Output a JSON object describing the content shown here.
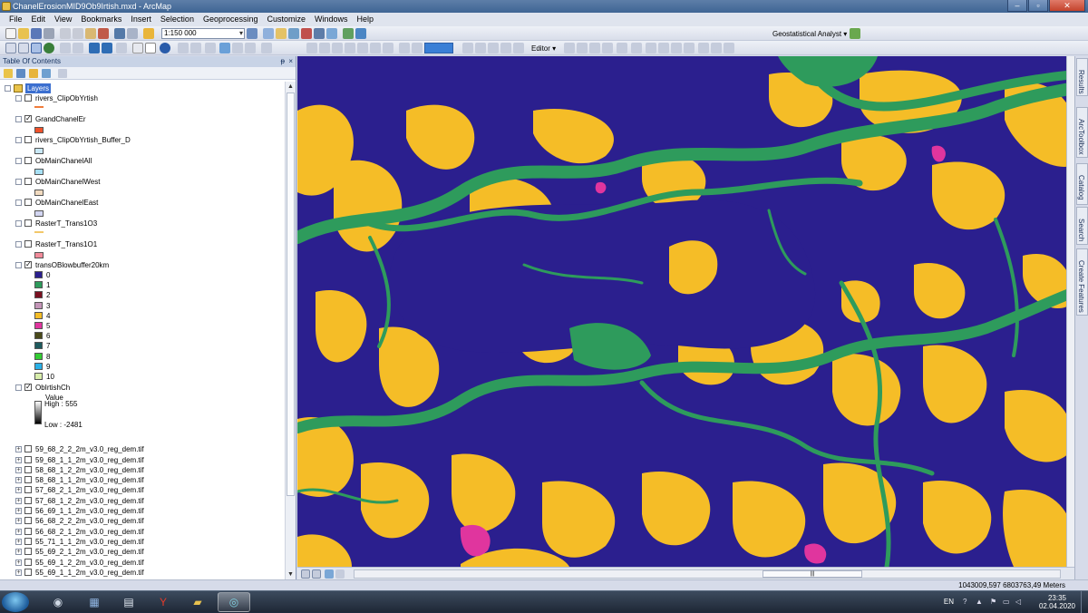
{
  "window": {
    "title": "ChanelErosionMID9Ob9Irtish.mxd - ArcMap"
  },
  "menu": [
    "File",
    "Edit",
    "View",
    "Bookmarks",
    "Insert",
    "Selection",
    "Geoprocessing",
    "Customize",
    "Windows",
    "Help"
  ],
  "toolbar": {
    "scale": "1:150 000",
    "geostatistical": "Geostatistical Analyst",
    "editor": "Editor"
  },
  "toc": {
    "title": "Table Of Contents",
    "pin_glyph": "ᵽ",
    "close_glyph": "×",
    "root": "Layers",
    "layers": [
      {
        "name": "rivers_ClipObYrtish",
        "checked": false,
        "symbol": "line",
        "color": "#f07d3c"
      },
      {
        "name": "GrandChanelEr",
        "checked": true,
        "symbol": "fill",
        "color": "#f0522b"
      },
      {
        "name": "rivers_ClipObYrtish_Buffer_D",
        "checked": false,
        "symbol": "fill",
        "color": "#c9e8f6"
      },
      {
        "name": "ObMainChanelAll",
        "checked": false,
        "symbol": "fill",
        "color": "#a7e0f4"
      },
      {
        "name": "ObMainChanelWest",
        "checked": false,
        "symbol": "fill",
        "color": "#f2dbc0"
      },
      {
        "name": "ObMainChanelEast",
        "checked": false,
        "symbol": "fill",
        "color": "#d3d6f2"
      },
      {
        "name": "RasterT_Trans1O3",
        "checked": false,
        "symbol": "line",
        "color": "#f2c86a"
      },
      {
        "name": "RasterT_Trans1O1",
        "checked": false,
        "symbol": "fill",
        "color": "#f28b9a"
      }
    ],
    "raster": {
      "name": "transOBlowbuffer20km",
      "checked": true,
      "classes": [
        {
          "label": "0",
          "color": "#2b1f8e"
        },
        {
          "label": "1",
          "color": "#2e9b5c"
        },
        {
          "label": "2",
          "color": "#7a1020"
        },
        {
          "label": "3",
          "color": "#c495b8"
        },
        {
          "label": "4",
          "color": "#f5bd27"
        },
        {
          "label": "5",
          "color": "#e0359e"
        },
        {
          "label": "6",
          "color": "#4a4a1a"
        },
        {
          "label": "7",
          "color": "#1e5a5e"
        },
        {
          "label": "8",
          "color": "#33cc33"
        },
        {
          "label": "9",
          "color": "#2ab0e6"
        },
        {
          "label": "10",
          "color": "#d8eeab"
        }
      ]
    },
    "dem": {
      "name": "ObIrtishCh",
      "checked": true,
      "value_label": "Value",
      "high": "High : 555",
      "low": "Low : -2481"
    },
    "tiles": [
      "59_68_2_2_2m_v3.0_reg_dem.tif",
      "59_68_1_1_2m_v3.0_reg_dem.tif",
      "58_68_1_2_2m_v3.0_reg_dem.tif",
      "58_68_1_1_2m_v3.0_reg_dem.tif",
      "57_68_2_1_2m_v3.0_reg_dem.tif",
      "57_68_1_2_2m_v3.0_reg_dem.tif",
      "56_69_1_1_2m_v3.0_reg_dem.tif",
      "56_68_2_2_2m_v3.0_reg_dem.tif",
      "56_68_2_1_2m_v3.0_reg_dem.tif",
      "55_71_1_1_2m_v3.0_reg_dem.tif",
      "55_69_2_1_2m_v3.0_reg_dem.tif",
      "55_69_1_2_2m_v3.0_reg_dem.tif",
      "55_69_1_1_2m_v3.0_reg_dem.tif"
    ]
  },
  "right_tabs": [
    "Results",
    "ArcToolbox",
    "Catalog",
    "Search",
    "Create Features"
  ],
  "status": {
    "coords": "1043009,597  6803763,49 Meters"
  },
  "taskbar": {
    "lang": "EN",
    "time": "23:35",
    "date": "02.04.2020"
  },
  "colors": {
    "water": "#2b1f8e",
    "channel": "#2e9b5c",
    "sand": "#f5bd27",
    "magenta": "#e0359e"
  }
}
